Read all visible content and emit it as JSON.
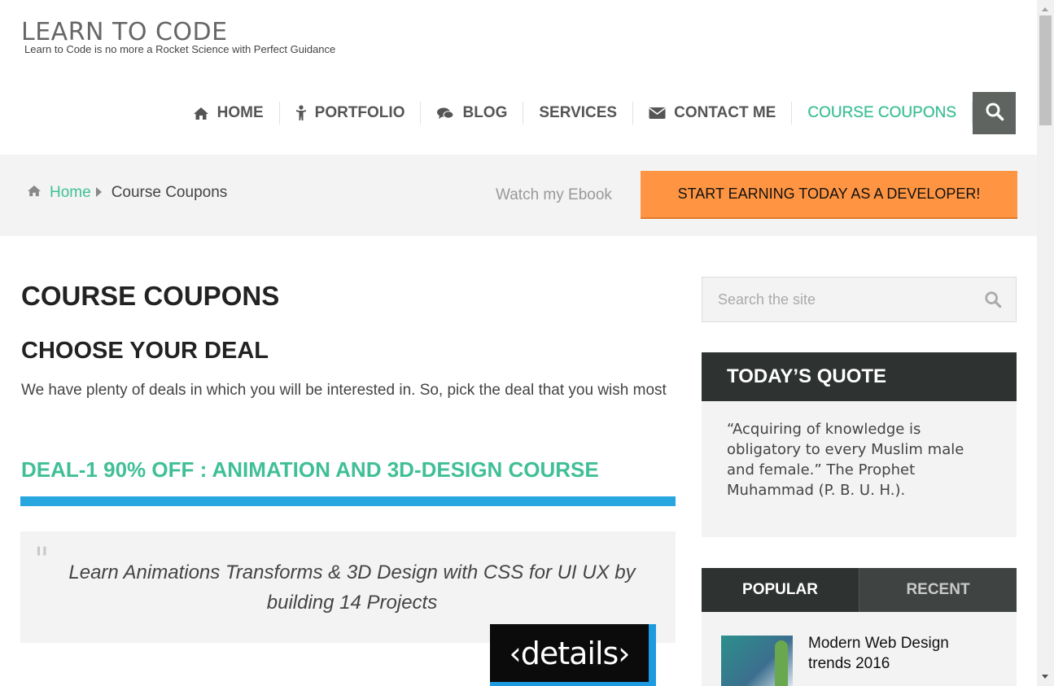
{
  "site": {
    "title": "LEARN TO CODE",
    "tagline": "Learn to Code is no more a Rocket Science with Perfect Guidance"
  },
  "nav": {
    "items": [
      {
        "label": "HOME",
        "icon": "home-icon"
      },
      {
        "label": "PORTFOLIO",
        "icon": "person-icon"
      },
      {
        "label": "BLOG",
        "icon": "comments-icon"
      },
      {
        "label": "SERVICES",
        "icon": ""
      },
      {
        "label": "CONTACT ME",
        "icon": "envelope-icon"
      },
      {
        "label": "COURSE COUPONS",
        "icon": "",
        "active": true
      }
    ],
    "search_icon": "search-icon"
  },
  "breadcrumb": {
    "home": "Home",
    "current": "Course Coupons"
  },
  "header_bar": {
    "ebook_link": "Watch my Ebook",
    "cta": "START EARNING TODAY AS A DEVELOPER!"
  },
  "main": {
    "page_title": "COURSE COUPONS",
    "subtitle": "CHOOSE YOUR DEAL",
    "intro": "We have plenty of deals in which you will be interested in. So, pick the deal that you wish most",
    "deal_title": "DEAL-1 90% OFF : ANIMATION AND 3D-DESIGN COURSE",
    "quote": "Learn Animations Transforms & 3D Design with CSS for UI UX by building 14 Projects",
    "details_image_text": "‹details›"
  },
  "sidebar": {
    "search_placeholder": "Search the site",
    "quote_widget": {
      "title": "TODAY’S QUOTE",
      "text": "“Acquiring of knowledge is obligatory to every Muslim male and female.” The Prophet Muhammad (P. B. U. H.)."
    },
    "tabs": [
      "POPULAR",
      "RECENT"
    ],
    "active_tab": "POPULAR",
    "posts": [
      {
        "title": "Modern Web Design trends 2016"
      }
    ]
  },
  "colors": {
    "accent_green": "#40bf97",
    "cta_orange": "#ff9542",
    "divider_blue": "#27a6e0",
    "dark_widget": "#2e3231"
  }
}
